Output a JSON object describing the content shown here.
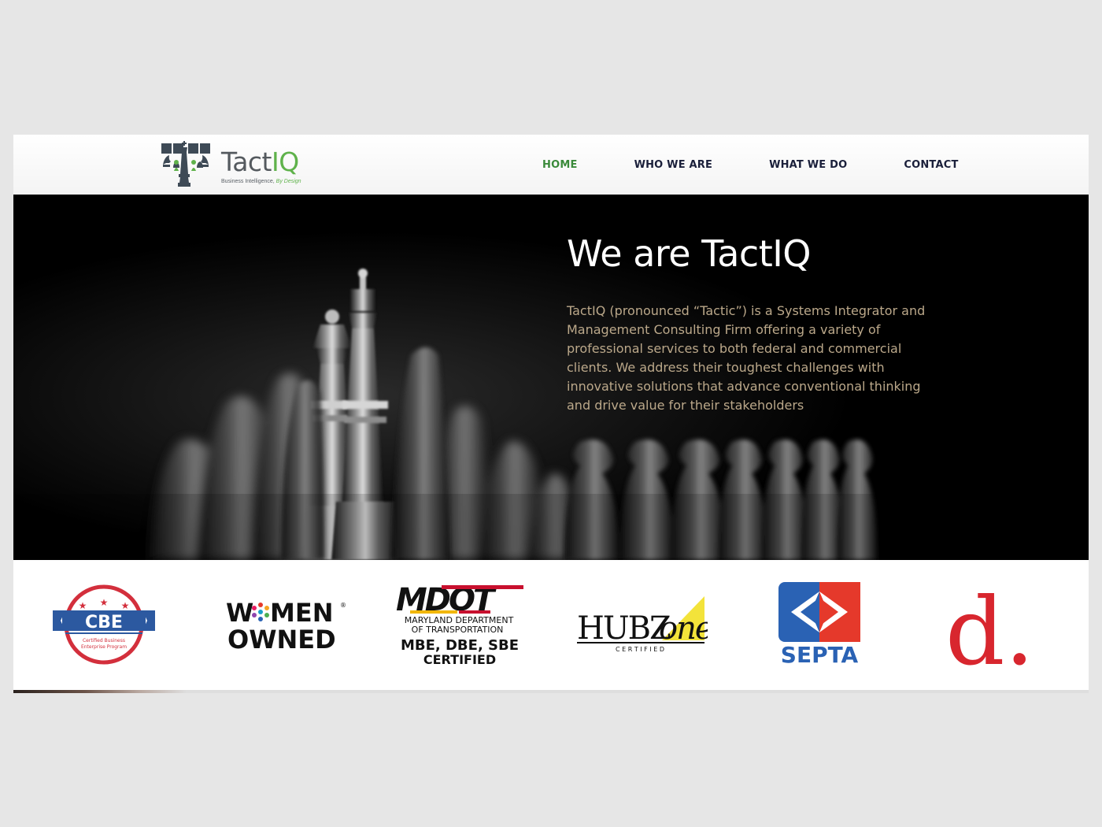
{
  "header": {
    "logo": {
      "icon": "chess-pieces-logo-icon",
      "name_part1": "Tact",
      "name_part2": "IQ",
      "tagline_part1": "Business Intelligence, ",
      "tagline_part2": "By Design"
    },
    "nav": [
      {
        "label": "HOME",
        "active": true
      },
      {
        "label": "WHO WE ARE",
        "active": false
      },
      {
        "label": "WHAT WE DO",
        "active": false
      },
      {
        "label": "CONTACT",
        "active": false
      }
    ]
  },
  "hero": {
    "background": "chess-pieces-photo",
    "title": "We are TactIQ",
    "text": "TactIQ (pronounced “Tactic”) is a Systems Integrator and Management Consulting Firm offering a variety of professional services to both federal and commercial clients. We address their toughest challenges with innovative solutions that advance conventional thinking and drive value for their stakeholders"
  },
  "certifications": [
    {
      "name": "cbe-logo",
      "text": "CBE",
      "subtext_line1": "Certified Business",
      "subtext_line2": "Enterprise Program"
    },
    {
      "name": "women-owned-logo",
      "line1_a": "W",
      "line1_b": "MEN",
      "registered": "®",
      "line2": "OWNED"
    },
    {
      "name": "mdot-logo",
      "acronym": "MDOT",
      "line1": "MARYLAND DEPARTMENT",
      "line2": "OF TRANSPORTATION",
      "line3": "MBE, DBE, SBE",
      "line4": "CERTIFIED"
    },
    {
      "name": "hubzone-logo",
      "text_a": "HUBZ",
      "text_b": "one",
      "subtext": "C E R T I F I E D"
    },
    {
      "name": "septa-logo",
      "text": "SEPTA"
    },
    {
      "name": "d-logo",
      "text": "d."
    }
  ],
  "colors": {
    "page_background": "#e6e6e6",
    "nav_text": "#1a1f3a",
    "nav_active": "#3a8a3a",
    "brand_green": "#5fb24b",
    "hero_text": "#bba88a",
    "cbe_red": "#d32f3c",
    "cbe_blue": "#2c59a0",
    "septa_blue": "#2a62b4",
    "septa_red": "#e5392b",
    "hubzone_yellow": "#f3e33a",
    "d_red": "#d8262e"
  }
}
